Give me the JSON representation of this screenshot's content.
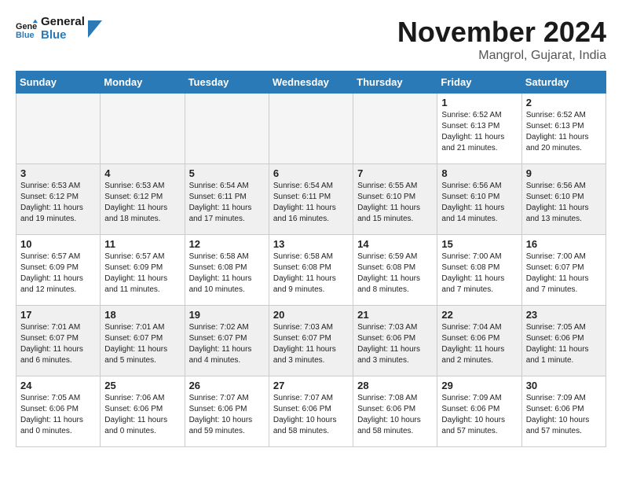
{
  "header": {
    "logo_line1": "General",
    "logo_line2": "Blue",
    "month": "November 2024",
    "location": "Mangrol, Gujarat, India"
  },
  "days_of_week": [
    "Sunday",
    "Monday",
    "Tuesday",
    "Wednesday",
    "Thursday",
    "Friday",
    "Saturday"
  ],
  "weeks": [
    [
      {
        "day": "",
        "empty": true
      },
      {
        "day": "",
        "empty": true
      },
      {
        "day": "",
        "empty": true
      },
      {
        "day": "",
        "empty": true
      },
      {
        "day": "",
        "empty": true
      },
      {
        "day": "1",
        "sunrise": "6:52 AM",
        "sunset": "6:13 PM",
        "daylight": "11 hours and 21 minutes."
      },
      {
        "day": "2",
        "sunrise": "6:52 AM",
        "sunset": "6:13 PM",
        "daylight": "11 hours and 20 minutes."
      }
    ],
    [
      {
        "day": "3",
        "sunrise": "6:53 AM",
        "sunset": "6:12 PM",
        "daylight": "11 hours and 19 minutes."
      },
      {
        "day": "4",
        "sunrise": "6:53 AM",
        "sunset": "6:12 PM",
        "daylight": "11 hours and 18 minutes."
      },
      {
        "day": "5",
        "sunrise": "6:54 AM",
        "sunset": "6:11 PM",
        "daylight": "11 hours and 17 minutes."
      },
      {
        "day": "6",
        "sunrise": "6:54 AM",
        "sunset": "6:11 PM",
        "daylight": "11 hours and 16 minutes."
      },
      {
        "day": "7",
        "sunrise": "6:55 AM",
        "sunset": "6:10 PM",
        "daylight": "11 hours and 15 minutes."
      },
      {
        "day": "8",
        "sunrise": "6:56 AM",
        "sunset": "6:10 PM",
        "daylight": "11 hours and 14 minutes."
      },
      {
        "day": "9",
        "sunrise": "6:56 AM",
        "sunset": "6:10 PM",
        "daylight": "11 hours and 13 minutes."
      }
    ],
    [
      {
        "day": "10",
        "sunrise": "6:57 AM",
        "sunset": "6:09 PM",
        "daylight": "11 hours and 12 minutes."
      },
      {
        "day": "11",
        "sunrise": "6:57 AM",
        "sunset": "6:09 PM",
        "daylight": "11 hours and 11 minutes."
      },
      {
        "day": "12",
        "sunrise": "6:58 AM",
        "sunset": "6:08 PM",
        "daylight": "11 hours and 10 minutes."
      },
      {
        "day": "13",
        "sunrise": "6:58 AM",
        "sunset": "6:08 PM",
        "daylight": "11 hours and 9 minutes."
      },
      {
        "day": "14",
        "sunrise": "6:59 AM",
        "sunset": "6:08 PM",
        "daylight": "11 hours and 8 minutes."
      },
      {
        "day": "15",
        "sunrise": "7:00 AM",
        "sunset": "6:08 PM",
        "daylight": "11 hours and 7 minutes."
      },
      {
        "day": "16",
        "sunrise": "7:00 AM",
        "sunset": "6:07 PM",
        "daylight": "11 hours and 7 minutes."
      }
    ],
    [
      {
        "day": "17",
        "sunrise": "7:01 AM",
        "sunset": "6:07 PM",
        "daylight": "11 hours and 6 minutes."
      },
      {
        "day": "18",
        "sunrise": "7:01 AM",
        "sunset": "6:07 PM",
        "daylight": "11 hours and 5 minutes."
      },
      {
        "day": "19",
        "sunrise": "7:02 AM",
        "sunset": "6:07 PM",
        "daylight": "11 hours and 4 minutes."
      },
      {
        "day": "20",
        "sunrise": "7:03 AM",
        "sunset": "6:07 PM",
        "daylight": "11 hours and 3 minutes."
      },
      {
        "day": "21",
        "sunrise": "7:03 AM",
        "sunset": "6:06 PM",
        "daylight": "11 hours and 3 minutes."
      },
      {
        "day": "22",
        "sunrise": "7:04 AM",
        "sunset": "6:06 PM",
        "daylight": "11 hours and 2 minutes."
      },
      {
        "day": "23",
        "sunrise": "7:05 AM",
        "sunset": "6:06 PM",
        "daylight": "11 hours and 1 minute."
      }
    ],
    [
      {
        "day": "24",
        "sunrise": "7:05 AM",
        "sunset": "6:06 PM",
        "daylight": "11 hours and 0 minutes."
      },
      {
        "day": "25",
        "sunrise": "7:06 AM",
        "sunset": "6:06 PM",
        "daylight": "11 hours and 0 minutes."
      },
      {
        "day": "26",
        "sunrise": "7:07 AM",
        "sunset": "6:06 PM",
        "daylight": "10 hours and 59 minutes."
      },
      {
        "day": "27",
        "sunrise": "7:07 AM",
        "sunset": "6:06 PM",
        "daylight": "10 hours and 58 minutes."
      },
      {
        "day": "28",
        "sunrise": "7:08 AM",
        "sunset": "6:06 PM",
        "daylight": "10 hours and 58 minutes."
      },
      {
        "day": "29",
        "sunrise": "7:09 AM",
        "sunset": "6:06 PM",
        "daylight": "10 hours and 57 minutes."
      },
      {
        "day": "30",
        "sunrise": "7:09 AM",
        "sunset": "6:06 PM",
        "daylight": "10 hours and 57 minutes."
      }
    ]
  ],
  "labels": {
    "sunrise": "Sunrise:",
    "sunset": "Sunset:",
    "daylight": "Daylight:"
  }
}
